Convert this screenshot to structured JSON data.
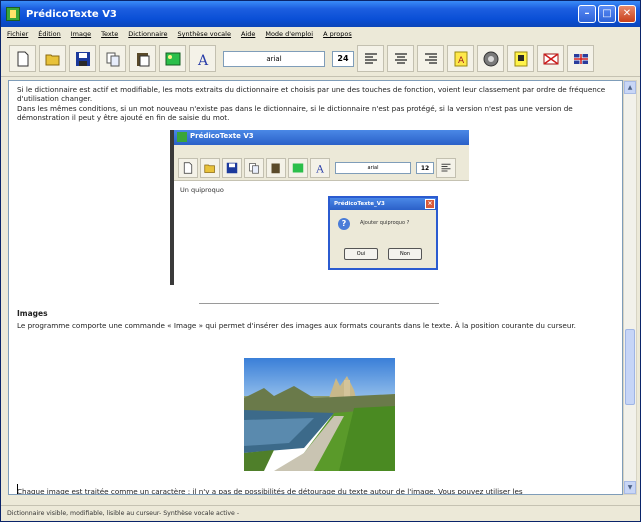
{
  "window": {
    "title": "PrédicoTexte V3"
  },
  "menu": [
    "Fichier",
    "Édition",
    "Image",
    "Texte",
    "Dictionnaire",
    "Synthèse vocale",
    "Aide",
    "Mode d'emploi",
    "A propos"
  ],
  "toolbar": {
    "font_value": "arial",
    "size_value": "24",
    "icons": [
      "new-file-icon",
      "open-folder-icon",
      "save-icon",
      "copy-icon",
      "paste-icon",
      "image-icon",
      "font-icon",
      "align-left-icon",
      "align-center-icon",
      "align-right-icon",
      "dictionary-icon",
      "speaker-icon",
      "help-icon",
      "flag-fr-icon",
      "flag-uk-icon"
    ]
  },
  "document": {
    "para1": "Si le dictionnaire est actif et modifiable, les mots extraits du dictionnaire et choisis par une des touches de fonction, voient leur classement par ordre de fréquence d'utilisation changer.",
    "para2": "Dans les mêmes conditions, si un mot nouveau n'existe pas dans le dictionnaire, si le dictionnaire n'est pas protégé, si la version n'est pas une version de démonstration il peut y être ajouté en fin de saisie du mot.",
    "embedded": {
      "title": "PrédicoTexte V3",
      "font_value": "arial",
      "size_value": "12",
      "body_text": "Un quiproquo",
      "dialog": {
        "title": "PrédicoTexte_V3",
        "message": "Ajouter quiproquo ?",
        "yes": "Oui",
        "no": "Non"
      }
    },
    "heading": "Images",
    "para3": "Le programme comporte une commande « Image » qui permet d'insérer des images aux formats courants dans le texte. À la position courante du curseur.",
    "para4": "Chaque image est traitée comme un caractère : il n'y a pas de possibilités de détourage du texte autour de l'image. Vous pouvez utiliser les"
  },
  "statusbar": {
    "text": "Dictionnaire visible,  modifiable, lisible au curseur- Synthèse vocale active -"
  },
  "colors": {
    "titlebar": "#0a4fd6",
    "chrome": "#ece9d8"
  }
}
